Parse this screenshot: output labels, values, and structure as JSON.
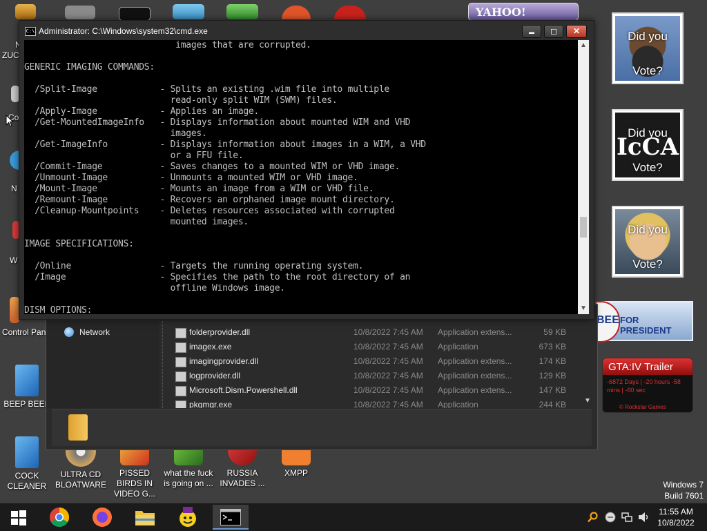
{
  "desktop": {
    "icons_bottom": [
      {
        "label": "COCK CLEANER",
        "icon": "cockcleaner-icon"
      },
      {
        "label": "ULTRA CD BLOATWARE",
        "icon": "cd-disc-icon"
      },
      {
        "label": "PISSED BIRDS IN VIDEO G...",
        "icon": "angry-birds-icon"
      },
      {
        "label": "what the fuck is going on ...",
        "icon": "angry-birds-space-icon"
      },
      {
        "label": "RUSSIA INVADES ...",
        "icon": "shortcut-icon"
      },
      {
        "label": "XMPP",
        "icon": "xampp-icon"
      }
    ],
    "icons_left": [
      {
        "label": "Control Pan",
        "icon": "control-panel-icon"
      },
      {
        "label": "BEEP BEEP",
        "icon": "beep-icon"
      }
    ],
    "fragments_left": [
      "N",
      "ZUC",
      "Co",
      "N",
      "W"
    ],
    "top_banner": "YAHOO!",
    "watermark": {
      "line1": "Windows 7",
      "line2": "Build 7601"
    }
  },
  "gadgets": [
    {
      "line1": "Did you",
      "line2": "Vote?",
      "color": "#4a6fa5"
    },
    {
      "line1": "Did you",
      "line2": "Vote?",
      "color": "#2a2a2a"
    },
    {
      "line1": "Did you",
      "line2": "Vote?",
      "color": "#7a5a3a"
    }
  ],
  "ad_banner": {
    "badge": "BEE",
    "text": "FOR PRESIDENT"
  },
  "gta_widget": {
    "title": "GTA:IV Trailer",
    "countdown": "-6872 Days | -20 hours -58 mins | -60 sec",
    "footer": "© Rockstar Games"
  },
  "cmd": {
    "title": "Administrator: C:\\Windows\\system32\\cmd.exe",
    "icon_label": "C:\\",
    "minimize": "▬",
    "maximize": "◻",
    "close": "✕",
    "scroll_up": "▲",
    "scroll_down": "▼",
    "console_text": "                             images that are corrupted.\n\nGENERIC IMAGING COMMANDS:\n\n  /Split-Image            - Splits an existing .wim file into multiple\n                            read-only split WIM (SWM) files.\n  /Apply-Image            - Applies an image.\n  /Get-MountedImageInfo   - Displays information about mounted WIM and VHD\n                            images.\n  /Get-ImageInfo          - Displays information about images in a WIM, a VHD\n                            or a FFU file.\n  /Commit-Image           - Saves changes to a mounted WIM or VHD image.\n  /Unmount-Image          - Unmounts a mounted WIM or VHD image.\n  /Mount-Image            - Mounts an image from a WIM or VHD file.\n  /Remount-Image          - Recovers an orphaned image mount directory.\n  /Cleanup-Mountpoints    - Deletes resources associated with corrupted\n                            mounted images.\n\nIMAGE SPECIFICATIONS:\n\n  /Online                 - Targets the running operating system.\n  /Image                  - Specifies the path to the root directory of an\n                            offline Windows image.\n\nDISM OPTIONS:"
  },
  "explorer": {
    "nav_network": "Network",
    "files": [
      {
        "name": "folderprovider.dll",
        "date": "10/8/2022 7:45 AM",
        "type": "Application extens...",
        "size": "59 KB"
      },
      {
        "name": "imagex.exe",
        "date": "10/8/2022 7:45 AM",
        "type": "Application",
        "size": "673 KB"
      },
      {
        "name": "imagingprovider.dll",
        "date": "10/8/2022 7:45 AM",
        "type": "Application extens...",
        "size": "174 KB"
      },
      {
        "name": "logprovider.dll",
        "date": "10/8/2022 7:45 AM",
        "type": "Application extens...",
        "size": "129 KB"
      },
      {
        "name": "Microsoft.Dism.Powershell.dll",
        "date": "10/8/2022 7:45 AM",
        "type": "Application extens...",
        "size": "147 KB"
      },
      {
        "name": "pkgmgr.exe",
        "date": "10/8/2022 7:45 AM",
        "type": "Application",
        "size": "244 KB"
      }
    ],
    "scroll_down": "▼"
  },
  "taskbar": {
    "items": [
      {
        "name": "start-button",
        "icon": "windows-logo-icon"
      },
      {
        "name": "chrome-button",
        "icon": "chrome-icon"
      },
      {
        "name": "firefox-button",
        "icon": "firefox-icon"
      },
      {
        "name": "explorer-button",
        "icon": "folder-icon"
      },
      {
        "name": "yahoo-messenger-button",
        "icon": "yahoo-messenger-icon"
      },
      {
        "name": "cmd-taskbar-button",
        "icon": "cmd-icon"
      }
    ],
    "time": "11:55 AM",
    "date": "10/8/2022",
    "tray_icons": [
      "search-tray-icon",
      "smiley-tray-icon",
      "network-tray-icon",
      "volume-tray-icon"
    ]
  },
  "colors": {
    "desktop_bg": "#3f3f3f",
    "console_bg": "#000000",
    "console_text": "#c0c0c0",
    "close_button": "#c4402c",
    "taskbar": "#1b1b1b",
    "gta_red": "#b01818"
  }
}
